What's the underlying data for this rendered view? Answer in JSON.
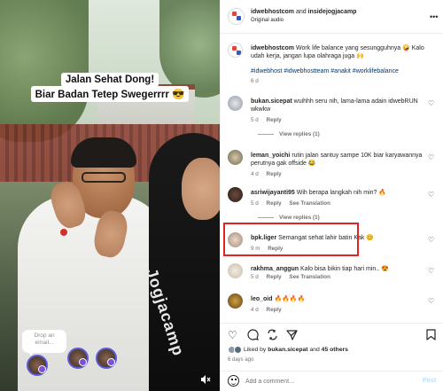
{
  "video": {
    "caption_line1": "Jalan Sehat Dong!",
    "caption_line2": "Biar Badan Tetep Swegerrrr 😎",
    "shirt_logo_text": "Jogjacamp",
    "drop_email_line1": "Drop an",
    "drop_email_line2": "email...",
    "mute_icon": "speaker-muted-icon"
  },
  "header": {
    "author": "idwebhostcom",
    "and_text": "and",
    "collaborator": "insidejogjacamp",
    "audio": "Original audio",
    "more_icon": "more-horizontal-icon"
  },
  "caption": {
    "username": "idwebhostcom",
    "text": "Work life balance yang sesungguhnya 🤪 Kalo udah kerja, jangan lupa olahraga juga 🙌",
    "hashtags": "#idwebhost #idwebhostteam #anakit #worklifebalance",
    "time": "6 d"
  },
  "comments": [
    {
      "username": "bukan.sicepat",
      "text": "wuihhh seru nih, lama-lama adain idwebRUN wkwkw",
      "time": "5 d",
      "reply": "Reply",
      "translation": "",
      "view_replies": "View replies (1)"
    },
    {
      "username": "leman_yoichi",
      "text": "rutin jalan santuy sampe 10K biar karyawannya perutnya gak offside 😂",
      "time": "4 d",
      "reply": "Reply",
      "translation": "",
      "view_replies": ""
    },
    {
      "username": "asriwijayanti95",
      "text": "Wih berapa langkah nih min? 🔥",
      "time": "5 d",
      "reply": "Reply",
      "translation": "See Translation",
      "view_replies": "View replies (1)"
    },
    {
      "username": "bpk.liger",
      "text": "Semangat sehat lahir batin Kak 😊",
      "time": "9 m",
      "reply": "Reply",
      "translation": "",
      "view_replies": ""
    },
    {
      "username": "rakhma_anggun",
      "text": "Kalo bisa bikin tiap hari min.. 😍",
      "time": "5 d",
      "reply": "Reply",
      "translation": "See Translation",
      "view_replies": ""
    },
    {
      "username": "leo_oid",
      "text": "🔥🔥🔥🔥",
      "time": "4 d",
      "reply": "Reply",
      "translation": "",
      "view_replies": ""
    }
  ],
  "likes": {
    "prefix": "Liked by",
    "user": "bukan.sicepat",
    "and_text": "and",
    "others": "45 others",
    "ago": "6 days ago"
  },
  "comment_bar": {
    "placeholder": "Add a comment…",
    "post_label": "Post"
  },
  "colors": {
    "highlight": "#e02424",
    "link": "#00376b",
    "muted": "#737373",
    "post_disabled": "#b2dffc"
  }
}
